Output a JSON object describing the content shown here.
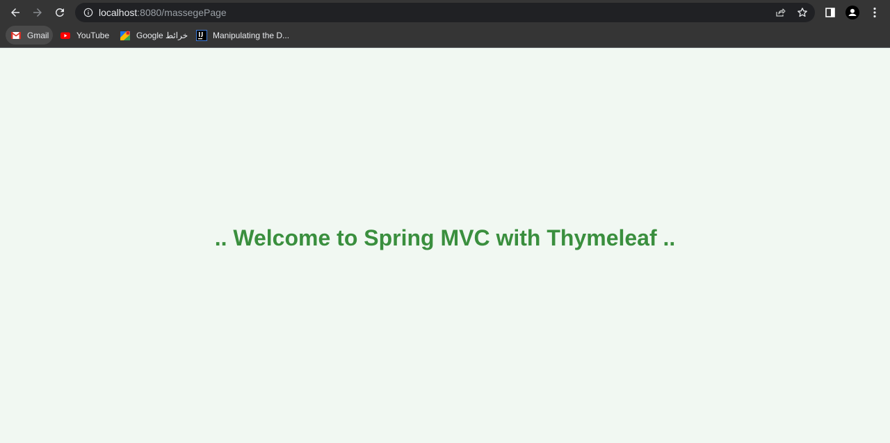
{
  "browser": {
    "address_bar": {
      "host": "localhost",
      "rest": ":8080/massegePage"
    },
    "bookmarks": [
      {
        "label": "Gmail",
        "icon": "gmail-icon"
      },
      {
        "label": "YouTube",
        "icon": "youtube-icon"
      },
      {
        "label": "Google خرائط",
        "icon": "google-maps-icon"
      },
      {
        "label": "Manipulating the D...",
        "icon": "intellij-icon"
      }
    ]
  },
  "page": {
    "heading": ".. Welcome to Spring MVC with Thymeleaf ..",
    "heading_color": "#3a8f3e",
    "background_color": "#f1f8f2"
  }
}
